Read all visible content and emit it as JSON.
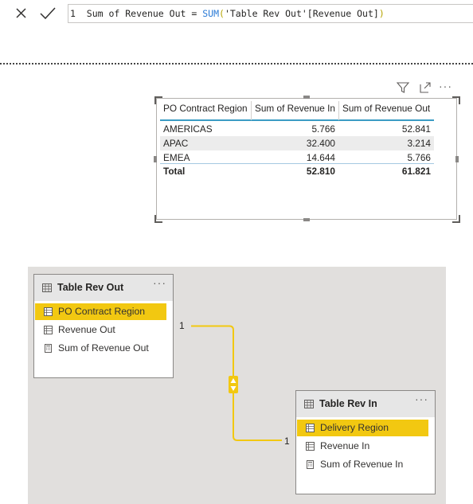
{
  "formula_bar": {
    "line_number": "1",
    "measure_name": "Sum of Revenue Out",
    "operator": "=",
    "function": "SUM",
    "open_paren": "(",
    "argument": "'Table Rev Out'[Revenue Out]",
    "close_paren": ")",
    "cancel_icon": "close-icon",
    "commit_icon": "checkmark-icon"
  },
  "visual_toolbar": {
    "filter_icon": "filter-icon",
    "focus_icon": "focus-mode-icon",
    "more_icon": "more-options-icon",
    "more_label": "···"
  },
  "table_visual": {
    "headers": [
      "PO Contract Region",
      "Sum of Revenue In",
      "Sum of Revenue Out"
    ],
    "rows": [
      [
        "AMERICAS",
        "5.766",
        "52.841"
      ],
      [
        "APAC",
        "32.400",
        "3.214"
      ],
      [
        "EMEA",
        "14.644",
        "5.766"
      ]
    ],
    "total": [
      "Total",
      "52.810",
      "61.821"
    ],
    "header_accent": "#3b9cc4"
  },
  "model": {
    "table_out": {
      "title": "Table Rev Out",
      "more": "···",
      "fields": [
        "PO Contract Region",
        "Revenue Out",
        "Sum of Revenue Out"
      ],
      "field_icons": [
        "column-icon",
        "column-icon",
        "measure-icon"
      ]
    },
    "table_in": {
      "title": "Table Rev In",
      "more": "···",
      "fields": [
        "Delivery Region",
        "Revenue In",
        "Sum of Revenue In"
      ],
      "field_icons": [
        "column-icon",
        "column-icon",
        "measure-icon"
      ]
    },
    "relationship": {
      "from_cardinality": "1",
      "to_cardinality": "1",
      "direction_icon": "bidirectional-arrow-icon",
      "color": "#f2c811"
    },
    "highlight_color": "#f2c811",
    "canvas_color": "#e1dfdd"
  }
}
